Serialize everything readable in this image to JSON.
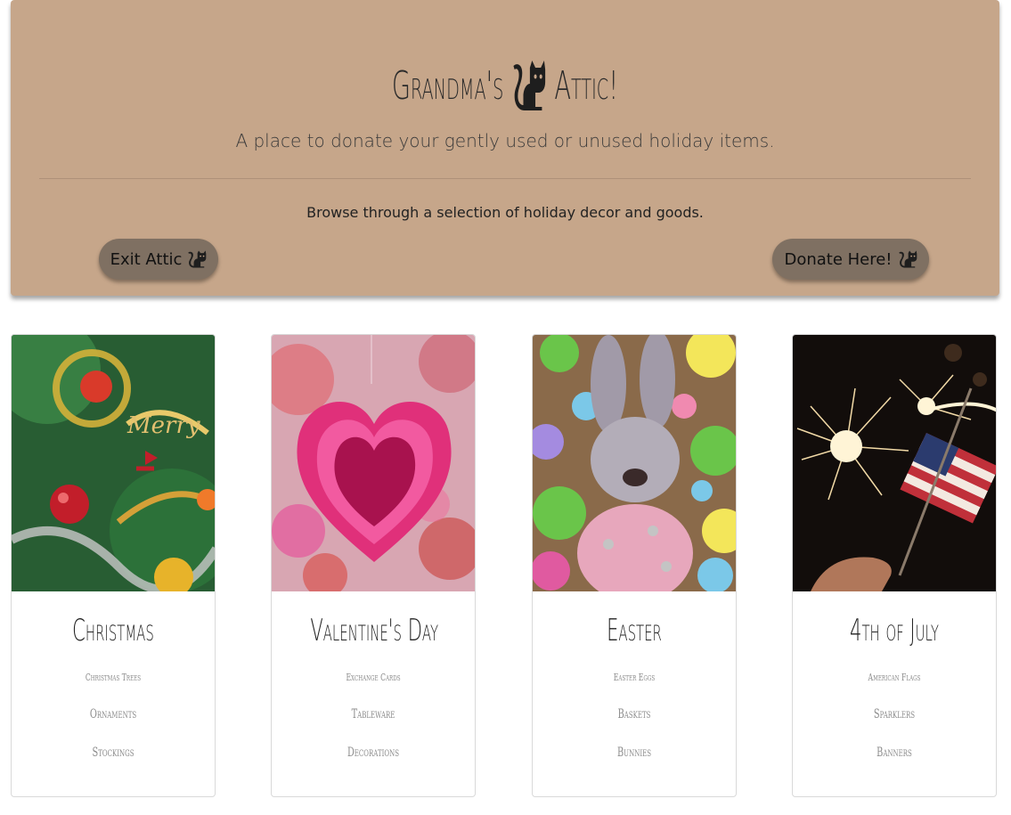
{
  "header": {
    "title_part1": "Grandma's",
    "title_part2": "Attic!",
    "lead": "A place to donate your gently used or unused holiday items.",
    "browse": "Browse through a selection of holiday decor and goods.",
    "exit_label": "Exit Attic",
    "donate_label": "Donate Here!",
    "background_color": "#c6a68a",
    "button_color": "#7f7062",
    "cat_icon": "cat-icon"
  },
  "cards": [
    {
      "title": "Christmas",
      "items": [
        "Christmas Trees",
        "Ornaments",
        "Stockings"
      ],
      "image": "christmas-tree-image"
    },
    {
      "title": "Valentine's Day",
      "items": [
        "Exchange Cards",
        "Tableware",
        "Decorations"
      ],
      "image": "pink-heart-image"
    },
    {
      "title": "Easter",
      "items": [
        "Easter Eggs",
        "Baskets",
        "Bunnies"
      ],
      "image": "easter-bunny-image"
    },
    {
      "title": "4th of July",
      "items": [
        "American Flags",
        "Sparklers",
        "Banners"
      ],
      "image": "sparkler-flag-image"
    }
  ]
}
